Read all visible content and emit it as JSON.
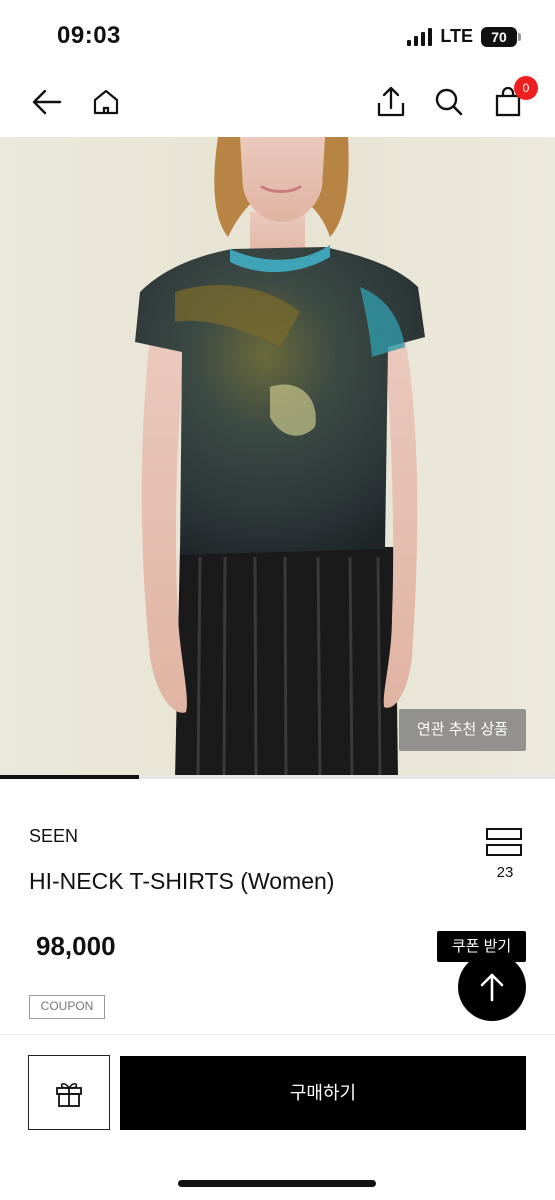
{
  "status_bar": {
    "time": "09:03",
    "network": "LTE",
    "battery": "70",
    "signal_bars": 4
  },
  "nav": {
    "back_icon": "back-arrow-icon",
    "home_icon": "home-icon",
    "share_icon": "share-icon",
    "search_icon": "search-icon",
    "cart_icon": "shopping-bag-icon",
    "cart_count": "0",
    "badge_color": "#ef1f1f"
  },
  "gallery": {
    "related_label": "연관 추천 상품",
    "progress_fraction": 0.25
  },
  "product": {
    "brand": "SEEN",
    "name": "HI-NECK T-SHIRTS (Women)",
    "price": "98,000",
    "layout_count": "23",
    "coupon_button": "쿠폰 받기",
    "coupon_tag": "COUPON"
  },
  "bottom_bar": {
    "gift_icon": "gift-icon",
    "buy_label": "구매하기"
  },
  "scroll_top_icon": "arrow-up-icon"
}
